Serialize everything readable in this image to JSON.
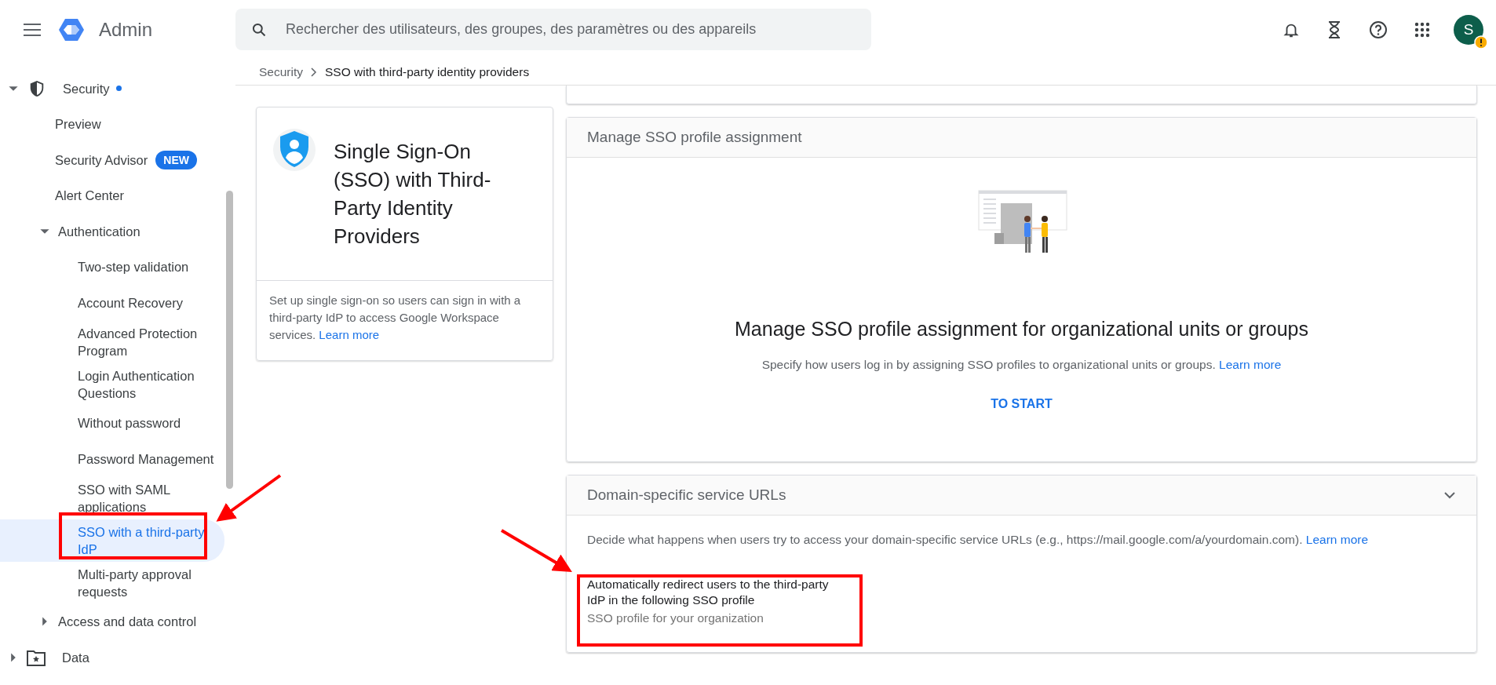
{
  "header": {
    "app_name": "Admin",
    "search": {
      "placeholder": "Rechercher des utilisateurs, des groupes, des paramètres ou des appareils"
    },
    "avatar_letter": "S",
    "avatar_warning": true
  },
  "sidebar": {
    "items": [
      {
        "label": "Security",
        "expanded": true,
        "selected": false,
        "notification_dot": true,
        "children": [
          {
            "label": "Preview",
            "selected": false
          },
          {
            "label": "Security Advisor",
            "selected": false,
            "badge": "NEW"
          },
          {
            "label": "Alert Center",
            "selected": false
          },
          {
            "label": "Authentication",
            "expanded": true,
            "selected": false,
            "children": [
              {
                "label": "Two-step validation",
                "selected": false
              },
              {
                "label": "Account Recovery",
                "selected": false
              },
              {
                "label": "Advanced Protection Program",
                "selected": false
              },
              {
                "label": "Login Authentication Questions",
                "selected": false
              },
              {
                "label": "Without password",
                "selected": false
              },
              {
                "label": "Password Management",
                "selected": false
              },
              {
                "label": "SSO with SAML applications",
                "selected": false
              },
              {
                "label": "SSO with a third-party IdP",
                "selected": true
              },
              {
                "label": "Multi-party approval requests",
                "selected": false
              }
            ]
          },
          {
            "label": "Access and data control",
            "expanded": false,
            "selected": false
          }
        ]
      },
      {
        "label": "Data",
        "expanded": false,
        "selected": false
      }
    ]
  },
  "breadcrumb": [
    "Security",
    "SSO with third-party identity providers"
  ],
  "info_card": {
    "title": "Single Sign-On (SSO) with Third-Party Identity Providers",
    "description": "Set up single sign-on so users can sign in with a third-party IdP to access Google Workspace services.",
    "link": "Learn more"
  },
  "assignment_card": {
    "header": "Manage SSO profile assignment",
    "title": "Manage SSO profile assignment for organizational units or groups",
    "description": "Specify how users log in by assigning SSO profiles to organizational units or groups.",
    "link": "Learn more",
    "button": "TO START"
  },
  "domain_card": {
    "header": "Domain-specific service URLs",
    "expanded": true,
    "description": "Decide what happens when users try to access your domain-specific service URLs (e.g., https://mail.google.com/a/yourdomain.com).",
    "link": "Learn more",
    "setting_label": "Automatically redirect users to the third-party IdP in the following SSO profile",
    "setting_value": "SSO profile for your organization"
  }
}
